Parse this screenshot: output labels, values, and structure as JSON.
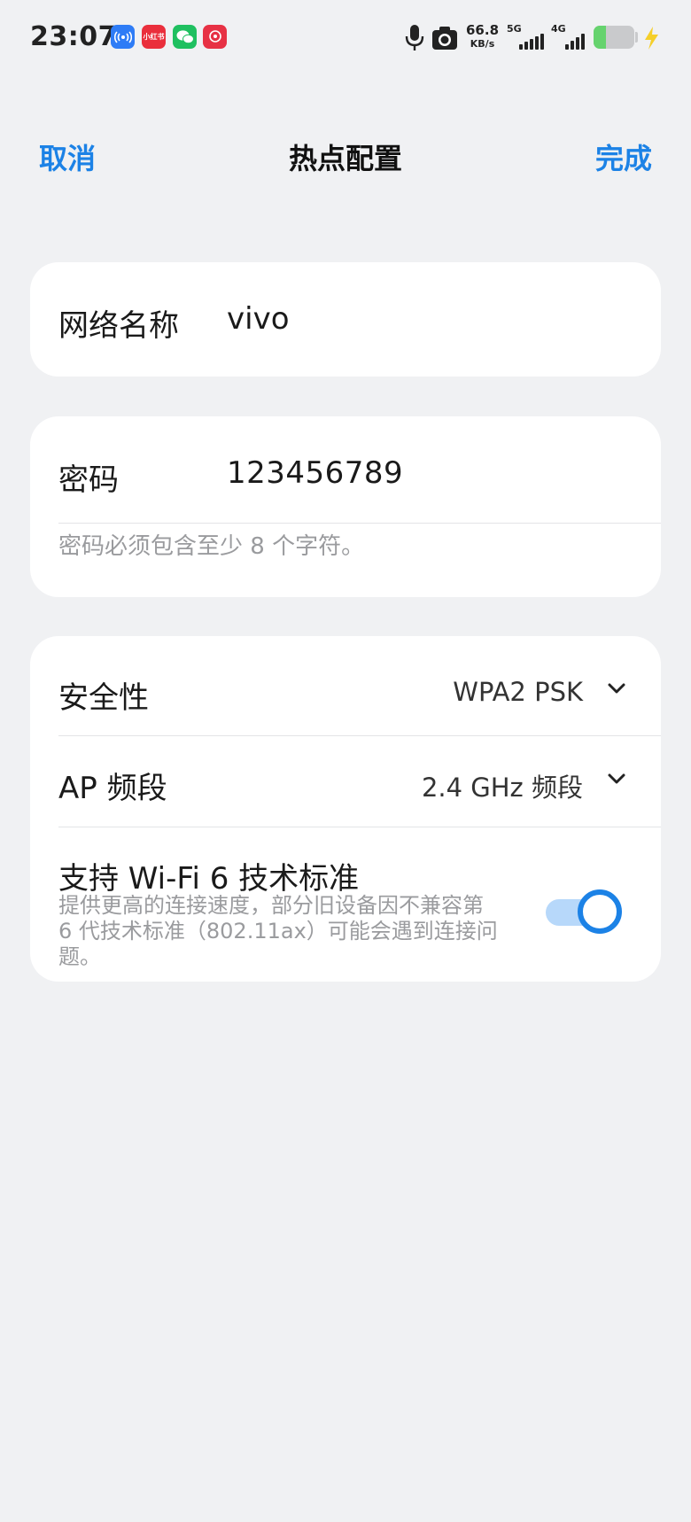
{
  "status_bar": {
    "time": "23:07",
    "apps": [
      "hotspot-icon",
      "xiaohongshu-icon",
      "wechat-icon",
      "taobao-icon"
    ],
    "xhs_label": "小红书",
    "speed_value": "66.8",
    "speed_unit": "KB/s",
    "network_1": "5G",
    "network_2": "4G",
    "battery_level": 0.3,
    "charging": true
  },
  "header": {
    "cancel_label": "取消",
    "title": "热点配置",
    "done_label": "完成"
  },
  "network_name": {
    "label": "网络名称",
    "value": "vivo"
  },
  "password": {
    "label": "密码",
    "value": "123456789",
    "hint": "密码必须包含至少 8 个字符。"
  },
  "options": {
    "security": {
      "label": "安全性",
      "value": "WPA2 PSK"
    },
    "band": {
      "label": "AP 频段",
      "value": "2.4 GHz 频段"
    },
    "wifi6": {
      "title": "支持 Wi-Fi 6 技术标准",
      "description": "提供更高的连接速度，部分旧设备因不兼容第 6 代技术标准（802.11ax）可能会遇到连接问题。",
      "enabled": true
    }
  },
  "colors": {
    "accent": "#1c82e6",
    "background": "#f0f1f3",
    "card": "#ffffff",
    "hint_text": "#9a9b9e",
    "toggle_track": "#b7d8fa"
  }
}
